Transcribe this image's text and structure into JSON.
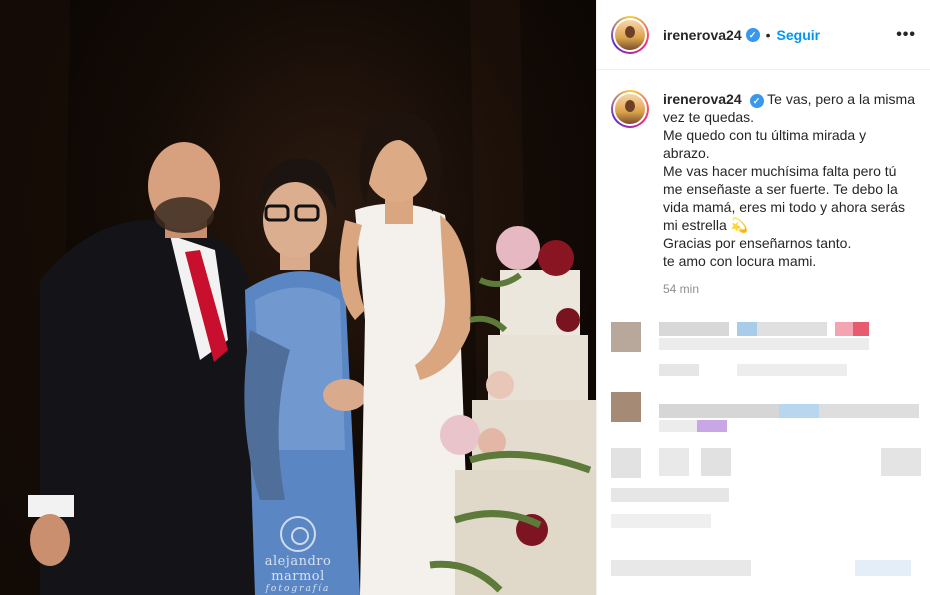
{
  "post": {
    "username": "irenerova24",
    "verified_mark": "✓",
    "separator": "•",
    "follow_label": "Seguir",
    "more_label": "•••"
  },
  "caption": {
    "username": "irenerova24",
    "lines": [
      "Te vas, pero a la misma",
      "vez te quedas.",
      "Me quedo con tu última mirada y",
      "abrazo.",
      "Me vas hacer muchísima falta pero tú",
      "me enseñaste a ser fuerte. Te debo la",
      "vida mamá, eres mi todo y ahora serás",
      "mi estrella 💫",
      "Gracias por enseñarnos tanto.",
      "te amo con locura mami."
    ],
    "timestamp": "54 min"
  },
  "photo": {
    "watermark_name": "alejandro marmol",
    "watermark_sub": "fotografía"
  },
  "colors": {
    "accent": "#0095f6",
    "verified": "#3897f0",
    "muted": "#8e8e8e"
  },
  "icons": [
    "verified-icon",
    "more-options-icon",
    "avatar-icon"
  ]
}
